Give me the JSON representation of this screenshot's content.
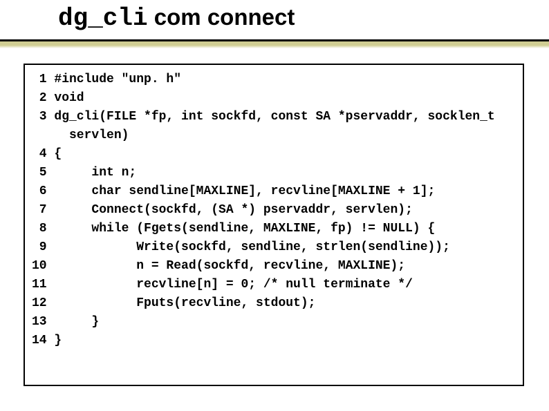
{
  "title_mono": "dg_cli",
  "title_rest": " com connect",
  "code_lines": [
    " 1 #include \"unp. h\"",
    " 2 void",
    " 3 dg_cli(FILE *fp, int sockfd, const SA *pservaddr, socklen_t",
    "     servlen)",
    " 4 {",
    " 5      int n;",
    " 6      char sendline[MAXLINE], recvline[MAXLINE + 1];",
    " 7      Connect(sockfd, (SA *) pservaddr, servlen);",
    " 8      while (Fgets(sendline, MAXLINE, fp) != NULL) {",
    " 9            Write(sockfd, sendline, strlen(sendline));",
    "10            n = Read(sockfd, recvline, MAXLINE);",
    "11            recvline[n] = 0; /* null terminate */",
    "12            Fputs(recvline, stdout);",
    "13      }",
    "14 }"
  ]
}
